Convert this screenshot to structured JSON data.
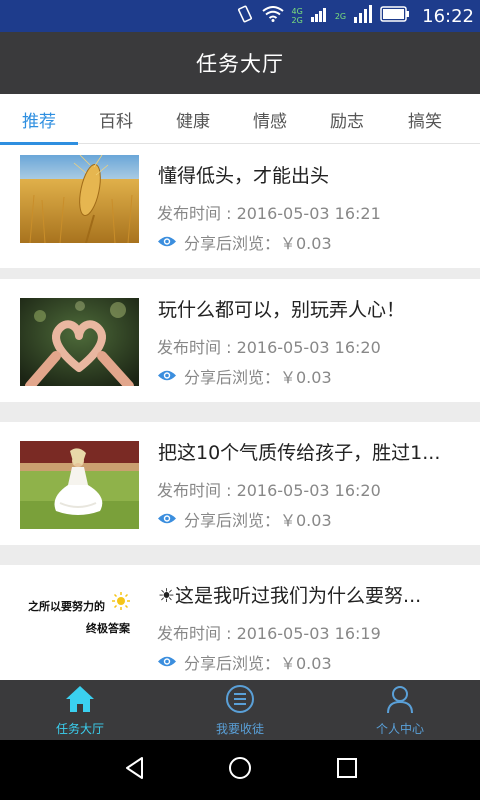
{
  "status_bar": {
    "time": "16:22",
    "network_top": "4G",
    "network_bottom": "2G",
    "network_second": "2G"
  },
  "header": {
    "title": "任务大厅"
  },
  "tabs": [
    {
      "label": "推荐",
      "active": true
    },
    {
      "label": "百科",
      "active": false
    },
    {
      "label": "健康",
      "active": false
    },
    {
      "label": "情感",
      "active": false
    },
    {
      "label": "励志",
      "active": false
    },
    {
      "label": "搞笑",
      "active": false
    }
  ],
  "articles": [
    {
      "title": "懂得低头，才能出头",
      "time": "发布时间 : 2016-05-03 16:21",
      "share": "分享后浏览：￥0.03",
      "thumb_icon": "wheat-photo"
    },
    {
      "title": "玩什么都可以，别玩弄人心！",
      "time": "发布时间 : 2016-05-03 16:20",
      "share": "分享后浏览：￥0.03",
      "thumb_icon": "heart-hands-photo"
    },
    {
      "title": "把这10个气质传给孩子，胜过1...",
      "time": "发布时间 : 2016-05-03 16:20",
      "share": "分享后浏览：￥0.03",
      "thumb_icon": "girl-in-white-dress-photo"
    },
    {
      "title": "☀这是我听过我们为什么要努...",
      "time": "发布时间 : 2016-05-03 16:19",
      "share": "分享后浏览：￥0.03",
      "thumb_icon": "text-image",
      "thumb_line1": "之所以要努力的",
      "thumb_line2": "终极答案"
    }
  ],
  "bottom_nav": [
    {
      "label": "任务大厅",
      "icon": "home-icon",
      "active": true
    },
    {
      "label": "我要收徒",
      "icon": "list-circle-icon",
      "active": false
    },
    {
      "label": "个人中心",
      "icon": "user-icon",
      "active": false
    }
  ],
  "colors": {
    "accent": "#2f8fe0",
    "header_bg": "#3a3a3c",
    "status_bg": "#1e3c8c",
    "nav_active": "#3ad0f0"
  }
}
